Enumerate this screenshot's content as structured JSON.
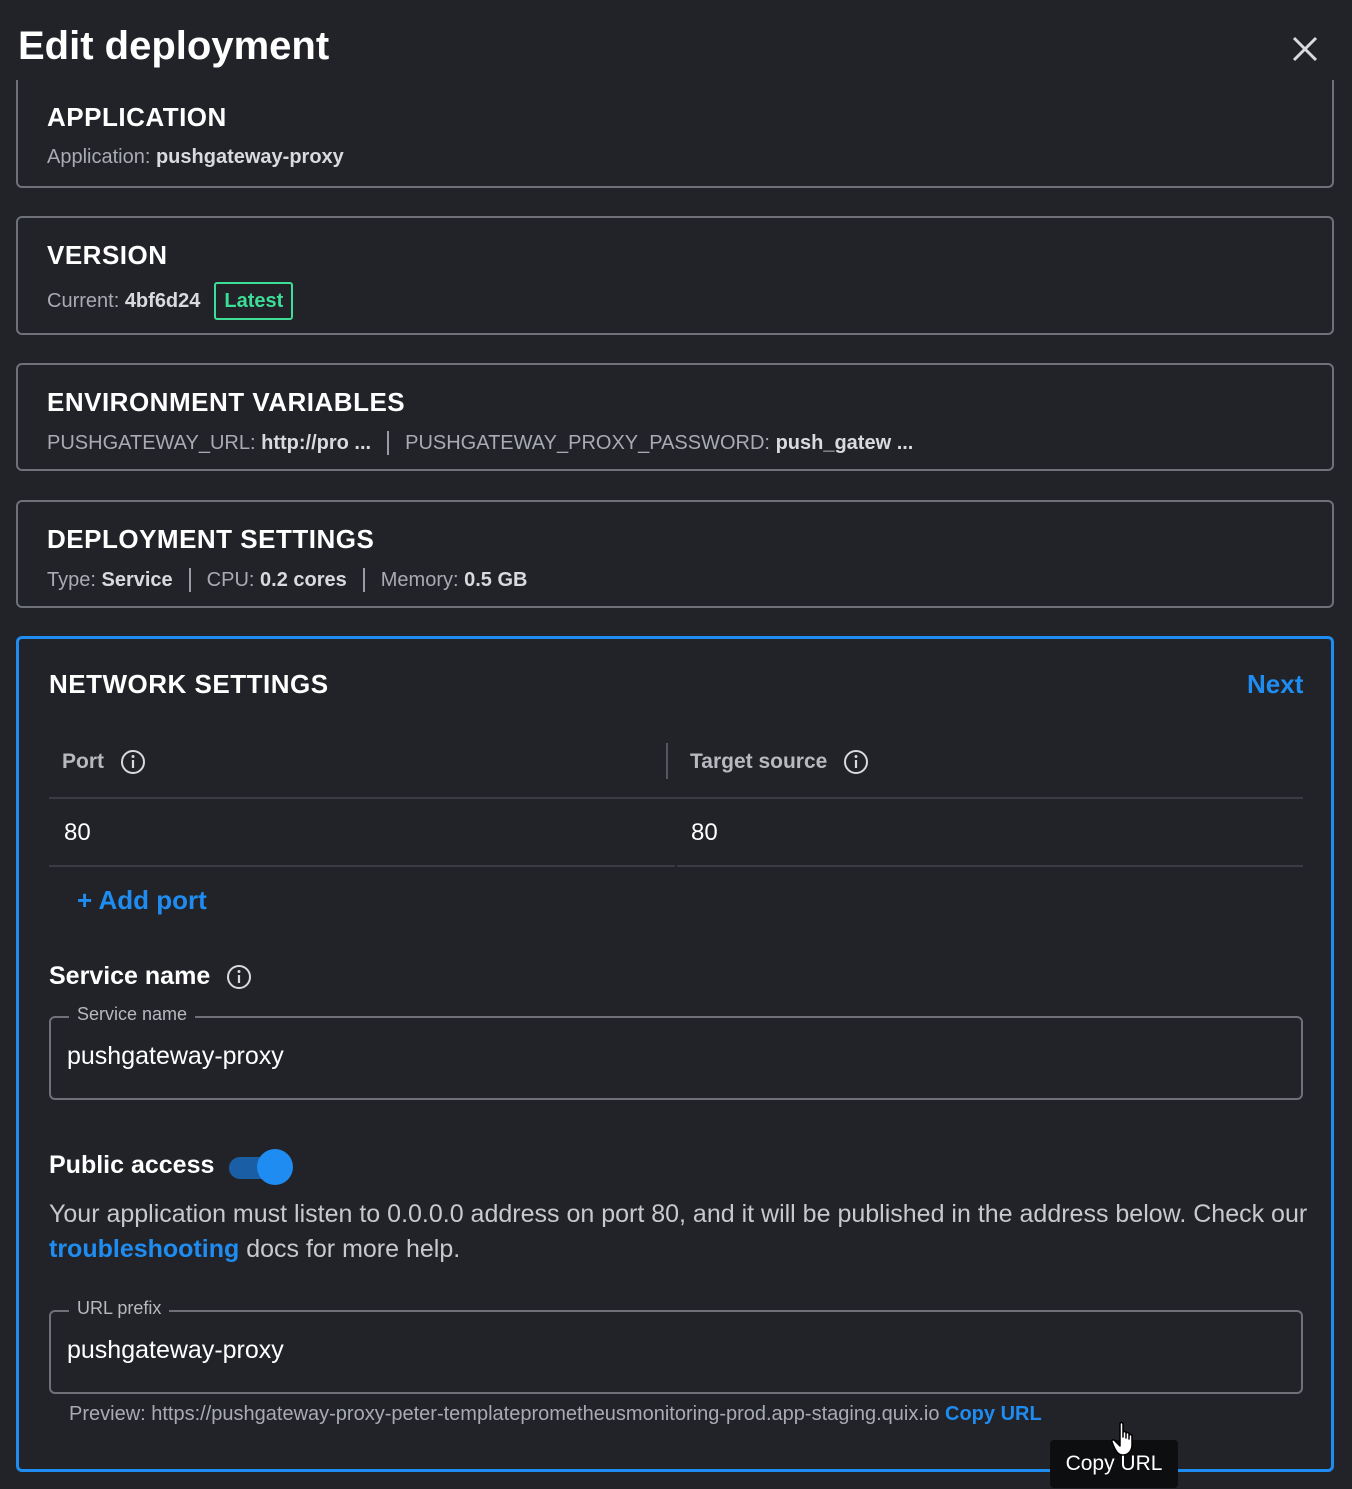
{
  "dialog": {
    "title": "Edit deployment"
  },
  "application": {
    "heading": "APPLICATION",
    "label": "Application:",
    "value": "pushgateway-proxy"
  },
  "version": {
    "heading": "VERSION",
    "label": "Current:",
    "value": "4bf6d24",
    "badge": "Latest"
  },
  "env_vars": {
    "heading": "ENVIRONMENT VARIABLES",
    "items": [
      {
        "key": "PUSHGATEWAY_URL:",
        "value": "http://pro ..."
      },
      {
        "key": "PUSHGATEWAY_PROXY_PASSWORD:",
        "value": "push_gatew ..."
      }
    ]
  },
  "deployment_settings": {
    "heading": "DEPLOYMENT SETTINGS",
    "items": [
      {
        "key": "Type:",
        "value": "Service"
      },
      {
        "key": "CPU:",
        "value": "0.2 cores"
      },
      {
        "key": "Memory:",
        "value": "0.5 GB"
      }
    ]
  },
  "network": {
    "heading": "NETWORK SETTINGS",
    "next_label": "Next",
    "table": {
      "headers": [
        "Port",
        "Target source"
      ],
      "rows": [
        [
          "80",
          "80"
        ]
      ]
    },
    "add_port_label": "+ Add port",
    "service_name": {
      "label": "Service name",
      "legend": "Service name",
      "value": "pushgateway-proxy"
    },
    "public_access": {
      "label": "Public access",
      "enabled": true,
      "desc_before": "Your application must listen to 0.0.0.0 address on port 80, and it will be published in the address below. Check our ",
      "desc_link": "troubleshooting",
      "desc_after": " docs for more help."
    },
    "url_prefix": {
      "legend": "URL prefix",
      "value": "pushgateway-proxy",
      "preview_label": "Preview: https://pushgateway-proxy-peter-templateprometheusmonitoring-prod.app-staging.quix.io",
      "copy_label": "Copy URL"
    }
  },
  "tooltip": {
    "text": "Copy URL"
  },
  "colors": {
    "accent": "#1e8cf0",
    "badge": "#3ddc97",
    "background": "#222329"
  }
}
